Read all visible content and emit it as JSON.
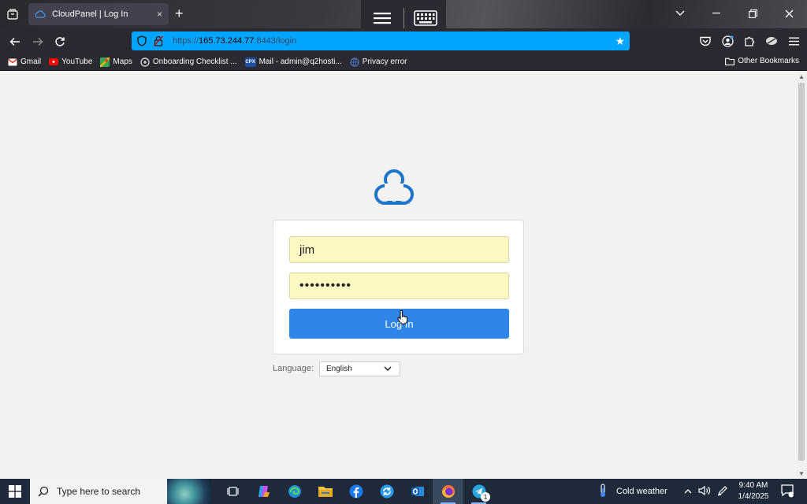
{
  "browser": {
    "tab": {
      "title": "CloudPanel | Log In",
      "close_icon": "×"
    },
    "new_tab_label": "+",
    "url": {
      "scheme": "https://",
      "host": "165.73.244.77",
      "rest": ":8443/login"
    },
    "bookmarks": [
      {
        "label": "Gmail",
        "icon": "gmail-icon",
        "color": "#ea4335"
      },
      {
        "label": "YouTube",
        "icon": "youtube-icon",
        "color": "#ff0000"
      },
      {
        "label": "Maps",
        "icon": "maps-icon",
        "color": "#34a853"
      },
      {
        "label": "Onboarding Checklist ...",
        "icon": "onboarding-icon",
        "color": "#888888"
      },
      {
        "label": "Mail - admin@q2hosti...",
        "icon": "mail-icon",
        "color": "#1e4fa3"
      },
      {
        "label": "Privacy error",
        "icon": "privacy-error-icon",
        "color": "#4a6fb5"
      }
    ],
    "other_bookmarks": "Other Bookmarks"
  },
  "login": {
    "username_value": "jim",
    "password_value": "••••••••••",
    "login_button": "Log In",
    "language_label": "Language:",
    "language_selected": "English"
  },
  "taskbar": {
    "search_placeholder": "Type here to search",
    "weather_text": "Cold weather",
    "time": "9:40 AM",
    "date": "1/4/2025",
    "telegram_badge": "1",
    "notification_badge": "1"
  },
  "colors": {
    "url_bar": "#00a5ff",
    "login_button": "#2f86e8",
    "input_fill": "#fbf8c4",
    "logo": "#1f73c9"
  }
}
